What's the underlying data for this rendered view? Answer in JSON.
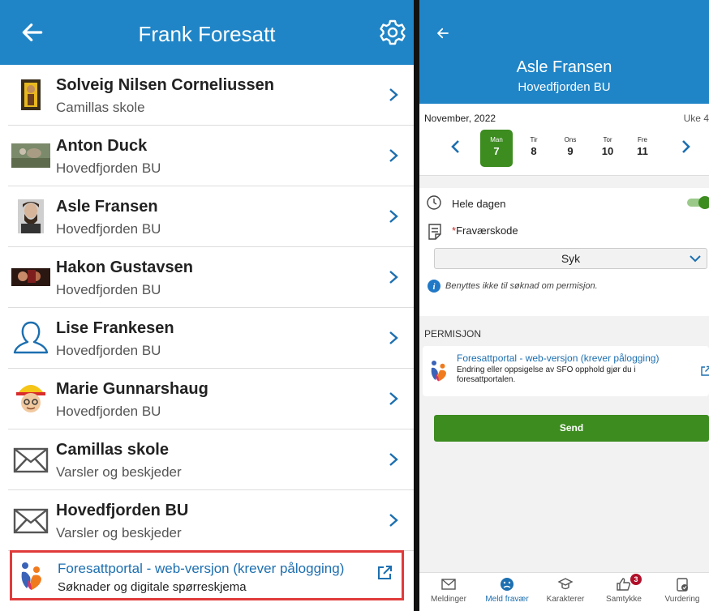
{
  "left": {
    "title": "Frank Foresatt",
    "contacts": [
      {
        "name": "Solveig Nilsen Corneliussen",
        "sub": "Camillas skole",
        "avatar": "photo-avatar"
      },
      {
        "name": "Anton Duck",
        "sub": "Hovedfjorden BU",
        "avatar": "photo-avatar"
      },
      {
        "name": "Asle Fransen",
        "sub": "Hovedfjorden BU",
        "avatar": "photo-avatar"
      },
      {
        "name": "Hakon Gustavsen",
        "sub": "Hovedfjorden BU",
        "avatar": "photo-avatar"
      },
      {
        "name": "Lise Frankesen",
        "sub": "Hovedfjorden BU",
        "avatar": "person-outline-icon"
      },
      {
        "name": "Marie Gunnarshaug",
        "sub": "Hovedfjorden BU",
        "avatar": "cartoon-avatar"
      },
      {
        "name": "Camillas skole",
        "sub": "Varsler og beskjeder",
        "avatar": "envelope-icon"
      },
      {
        "name": "Hovedfjorden BU",
        "sub": "Varsler og beskjeder",
        "avatar": "envelope-icon"
      }
    ],
    "portal": {
      "title": "Foresattportal - web-versjon (krever pålogging)",
      "sub": "Søknader og digitale spørreskjema"
    }
  },
  "right": {
    "name": "Asle Fransen",
    "school": "Hovedfjorden BU",
    "calendar": {
      "month": "November, 2022",
      "week": "Uke 4",
      "days": [
        {
          "name": "Man",
          "date": "7",
          "selected": true
        },
        {
          "name": "Tir",
          "date": "8",
          "selected": false
        },
        {
          "name": "Ons",
          "date": "9",
          "selected": false
        },
        {
          "name": "Tor",
          "date": "10",
          "selected": false
        },
        {
          "name": "Fre",
          "date": "11",
          "selected": false
        }
      ]
    },
    "form": {
      "whole_day_label": "Hele dagen",
      "whole_day_on": true,
      "code_required_mark": "*",
      "code_label": "Fraværskode",
      "code_value": "Syk",
      "note": "Benyttes ikke til søknad om permisjon."
    },
    "permission": {
      "section_label": "PERMISJON",
      "title": "Foresattportal - web-versjon (krever pålogging)",
      "desc": "Endring eller oppsigelse av SFO opphold gjør du i foresattportalen."
    },
    "send_label": "Send",
    "tabs": [
      {
        "label": "Meldinger",
        "icon": "envelope-icon",
        "active": false
      },
      {
        "label": "Meld fravær",
        "icon": "sick-face-icon",
        "active": true
      },
      {
        "label": "Karakterer",
        "icon": "graduation-cap-icon",
        "active": false
      },
      {
        "label": "Samtykke",
        "icon": "thumbs-icon",
        "active": false,
        "badge": "3"
      },
      {
        "label": "Vurdering",
        "icon": "clipboard-check-icon",
        "active": false
      }
    ]
  },
  "colors": {
    "header_blue": "#2085c7",
    "accent_green": "#3c8c1f",
    "link_blue": "#1c6fb0",
    "highlight_red": "#e13b3b"
  }
}
